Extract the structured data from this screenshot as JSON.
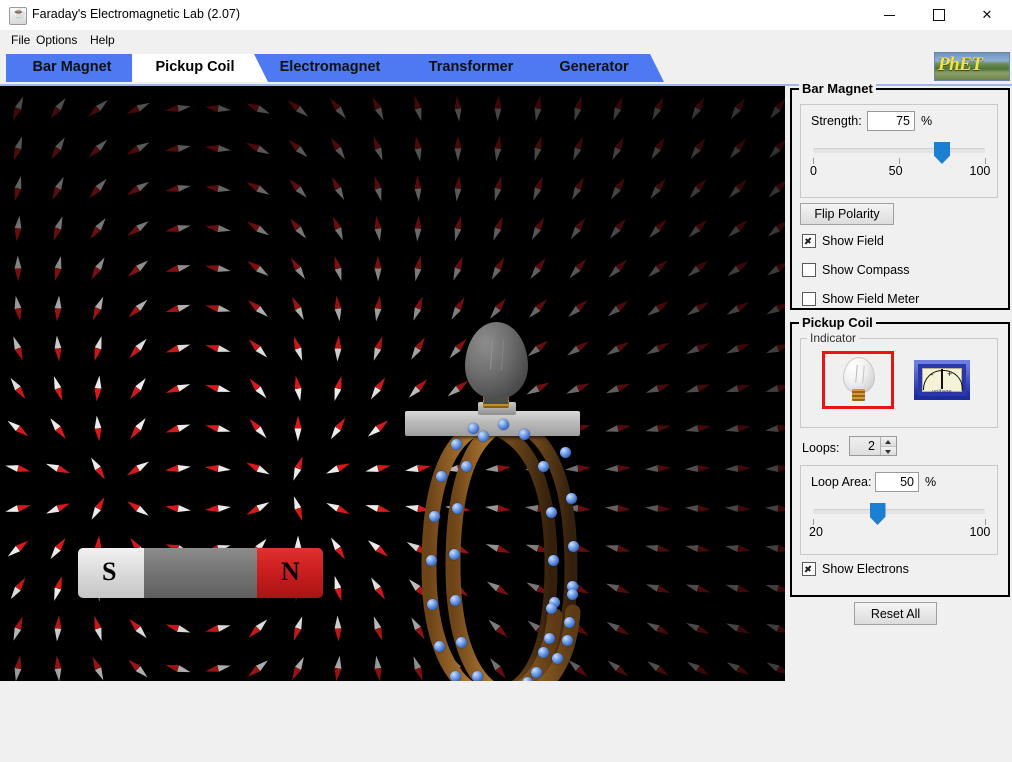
{
  "window": {
    "title": "Faraday's Electromagnetic Lab (2.07)",
    "icon": "java-coffee-icon",
    "minimize": "—",
    "maximize": "□",
    "close": "✕"
  },
  "menubar": {
    "items": [
      "File",
      "Options",
      "Help"
    ]
  },
  "tabs": [
    {
      "label": "Bar Magnet",
      "selected": false
    },
    {
      "label": "Pickup Coil",
      "selected": true
    },
    {
      "label": "Electromagnet",
      "selected": false
    },
    {
      "label": "Transformer",
      "selected": false
    },
    {
      "label": "Generator",
      "selected": false
    }
  ],
  "logo": {
    "text": "PhET"
  },
  "canvas": {
    "magnet": {
      "south_label": "S",
      "north_label": "N"
    },
    "field_visible": true,
    "electrons_visible": true
  },
  "bar_magnet_panel": {
    "title": "Bar Magnet",
    "strength_label": "Strength:",
    "strength_value": "75",
    "strength_unit": "%",
    "strength_min": "0",
    "strength_mid": "50",
    "strength_max": "100",
    "flip_polarity_label": "Flip Polarity",
    "checkboxes": [
      {
        "label": "Show Field",
        "checked": true
      },
      {
        "label": "Show Compass",
        "checked": false
      },
      {
        "label": "Show Field Meter",
        "checked": false
      }
    ]
  },
  "pickup_coil_panel": {
    "title": "Pickup Coil",
    "indicator_label": "Indicator",
    "indicator_options": [
      {
        "name": "lightbulb",
        "selected": true
      },
      {
        "name": "voltmeter",
        "selected": false,
        "face_label": "voltage",
        "minus": "-",
        "plus": "+"
      }
    ],
    "loops_label": "Loops:",
    "loops_value": "2",
    "loop_area_label": "Loop Area:",
    "loop_area_value": "50",
    "loop_area_unit": "%",
    "loop_area_min": "20",
    "loop_area_max": "100",
    "show_electrons": {
      "label": "Show Electrons",
      "checked": true
    }
  },
  "reset": {
    "label": "Reset All"
  },
  "colors": {
    "tab_blue": "#4d79f2",
    "slider_blue": "#1b7fd4",
    "selection_red": "#ee1111",
    "magnet_north": "#cc1f1f",
    "coil_copper": "#a8702e",
    "electron_blue": "#6f9de8",
    "panel_bg": "#f0f0f0",
    "canvas_bg": "#000000"
  }
}
